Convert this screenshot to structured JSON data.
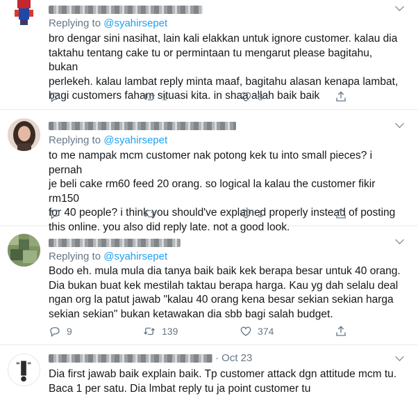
{
  "tweets": [
    {
      "replying_prefix": "Replying to ",
      "mention": "@syahirsepet",
      "lines": [
        "bro dengar sini nasihat, lain kali elakkan untuk ignore customer. kalau dia",
        "taktahu tentang cake tu or permintaan tu mengarut please bagitahu, bukan",
        "perlekeh. kalau lambat reply minta maaf, bagitahu alasan kenapa lambat,",
        "bagi customers faham situasi kita. in shaa allah baik baik"
      ],
      "retweets": "1",
      "likes": "8"
    },
    {
      "replying_prefix": "Replying to ",
      "mention": "@syahirsepet",
      "lines": [
        "to me nampak mcm customer nak potong kek tu into small pieces? i pernah",
        "je beli cake rm60 feed 20 orang. so logical la kalau the customer fikir rm150",
        "for 40 people? i think you should've explained properly instead of posting",
        "this online. you also did reply late. not a good look."
      ],
      "retweets": "",
      "likes": "1"
    },
    {
      "replying_prefix": "Replying to ",
      "mention": "@syahirsepet",
      "lines": [
        "Bodo eh. mula mula dia tanya baik baik kek berapa besar untuk 40 orang.",
        "Dia bukan buat kek mestilah taktau berapa harga. Kau yg dah selalu deal",
        "ngan org la patut jawab \"kalau 40 orang kena besar sekian sekian harga",
        "sekian sekian\" bukan ketawakan dia sbb bagi salah budget."
      ],
      "replies": "9",
      "retweets": "139",
      "likes": "374"
    },
    {
      "date": "· Oct 23",
      "lines": [
        "Dia first jawab baik explain baik. Tp customer attack dgn attitude mcm tu.",
        "Baca 1 per satu. Dia lmbat reply tu ja point customer tu"
      ]
    }
  ],
  "colors": {
    "link": "#1da1f2",
    "muted": "#657786",
    "text": "#14171a",
    "divider": "#e6ecf0"
  },
  "icons": [
    "reply-icon",
    "retweet-icon",
    "like-icon",
    "share-icon",
    "chevron-down-icon"
  ]
}
